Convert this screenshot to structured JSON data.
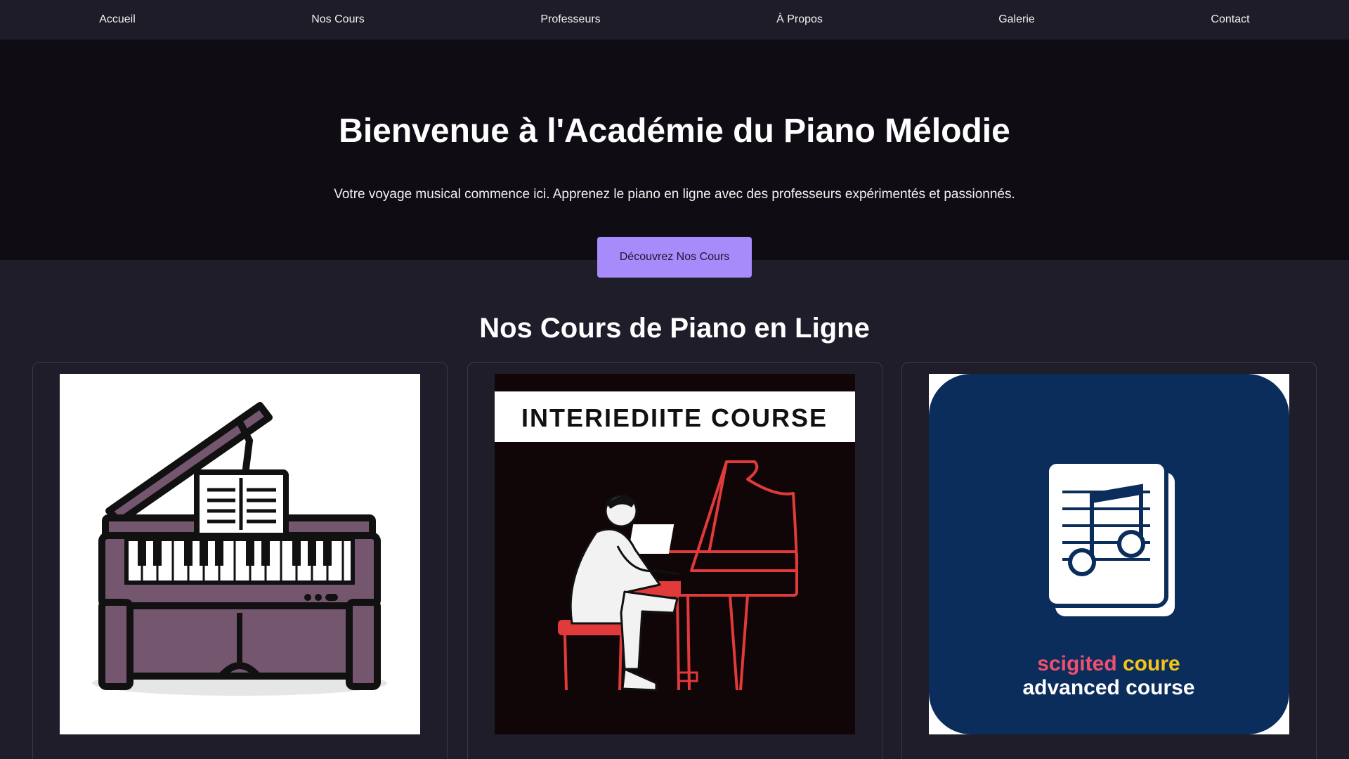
{
  "nav": {
    "items": [
      {
        "label": "Accueil"
      },
      {
        "label": "Nos Cours"
      },
      {
        "label": "Professeurs"
      },
      {
        "label": "À Propos"
      },
      {
        "label": "Galerie"
      },
      {
        "label": "Contact"
      }
    ]
  },
  "hero": {
    "title": "Bienvenue à l'Académie du Piano Mélodie",
    "subtitle": "Votre voyage musical commence ici. Apprenez le piano en ligne avec des professeurs expérimentés et passionnés.",
    "cta_label": "Découvrez Nos Cours"
  },
  "courses": {
    "title": "Nos Cours de Piano en Ligne",
    "cards": [
      {
        "image": "upright-piano-illustration"
      },
      {
        "image": "pianist-grand-piano-illustration",
        "banner": "INTERIEDIITE COURSE"
      },
      {
        "image": "sheet-music-icon",
        "caption_top_a": "scigited",
        "caption_top_b": "coure",
        "caption_bottom": "advanced course"
      }
    ]
  },
  "colors": {
    "nav_bg": "#1e1c28",
    "hero_bg": "#0f0d13",
    "page_bg": "#1f1d29",
    "accent": "#a78bfa",
    "card_border": "#3a3846"
  }
}
